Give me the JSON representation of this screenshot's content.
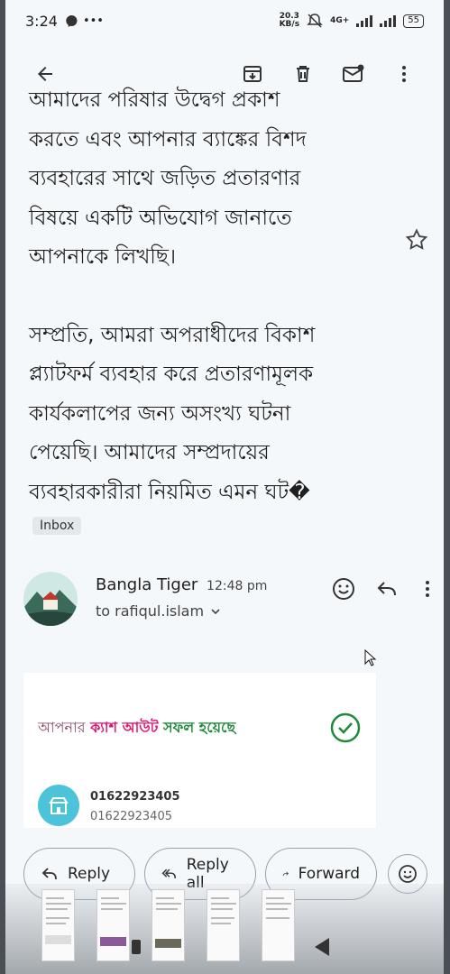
{
  "status_bar": {
    "time": "3:24",
    "net_speed_value": "20.3",
    "net_speed_unit": "KB/s",
    "network": "4G+",
    "battery": "55"
  },
  "email": {
    "body_partial_top": "আমাদের পরিষার উদ্বেগ প্রকাশ",
    "body_lines_1": [
      "করতে এবং আপনার ব্যাঙ্কের বিশদ",
      "ব্যবহারের সাথে জড়িত প্রতারণার",
      "বিষয়ে একটি অভিযোগ জানাতে",
      "আপনাকে লিখছি।"
    ],
    "body_lines_2": [
      "সম্প্রতি, আমরা অপরাধীদের বিকাশ",
      "প্ল্যাটফর্ম ব্যবহার করে প্রতারণামূলক",
      "কার্যকলাপের জন্য অসংখ্য ঘটনা",
      "পেয়েছি। আমাদের সম্প্রদায়ের",
      "ব্যবহারকারীরা নিয়মিত এমন ঘট�"
    ],
    "label": "Inbox"
  },
  "sender": {
    "name": "Bangla Tiger",
    "time": "12:48 pm",
    "to": "to rafiqul.islam"
  },
  "card": {
    "title_part1": "আপনার",
    "title_part2": "ক্যাশ আউট",
    "title_part3": "সফল হয়েছে",
    "number1": "01622923405",
    "number2": "01622923405"
  },
  "actions": {
    "reply": "Reply",
    "reply_all": "Reply all",
    "forward": "Forward"
  },
  "colors": {
    "accent_pink": "#e2136e",
    "success_green": "#1e8a3a",
    "card_icon": "#4cc3d9"
  }
}
